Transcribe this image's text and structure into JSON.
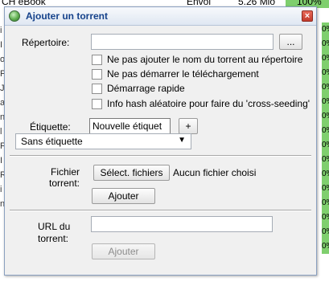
{
  "background": {
    "top_left_text": "CH eBook",
    "top_mid_text": "Envoi",
    "top_size_text": "5.26 Mio",
    "top_percent_text": "100%",
    "left_chars": [
      "i",
      "I",
      "o",
      "F",
      "J",
      "a",
      "n",
      "l",
      "F",
      "I",
      "R",
      "i",
      "n"
    ],
    "right_cells": [
      "0%",
      "0%",
      "0%",
      "0%",
      "0%",
      "0%",
      "0%",
      "0%",
      "0%",
      "0%",
      "0%",
      "0%",
      "0%",
      "0%",
      "0%",
      "0%"
    ]
  },
  "dialog": {
    "title": "Ajouter un torrent",
    "close_symbol": "×",
    "directory_label": "Répertoire:",
    "directory_value": "",
    "browse_button": "...",
    "options": [
      "Ne pas ajouter le nom du torrent au répertoire",
      "Ne pas démarrer le téléchargement",
      "Démarrage rapide",
      "Info hash aléatoire pour faire du 'cross-seeding'"
    ],
    "label_label": "Étiquette:",
    "new_label_field": "Nouvelle étiquet",
    "add_label_button": "+",
    "label_select_value": "Sans étiquette",
    "file_label_line1": "Fichier",
    "file_label_line2": "torrent:",
    "choose_files_button": "Sélect. fichiers",
    "no_file_text": "Aucun fichier choisi",
    "add_file_button": "Ajouter",
    "url_label_line1": "URL du",
    "url_label_line2": "torrent:",
    "url_value": "",
    "add_url_button": "Ajouter"
  }
}
